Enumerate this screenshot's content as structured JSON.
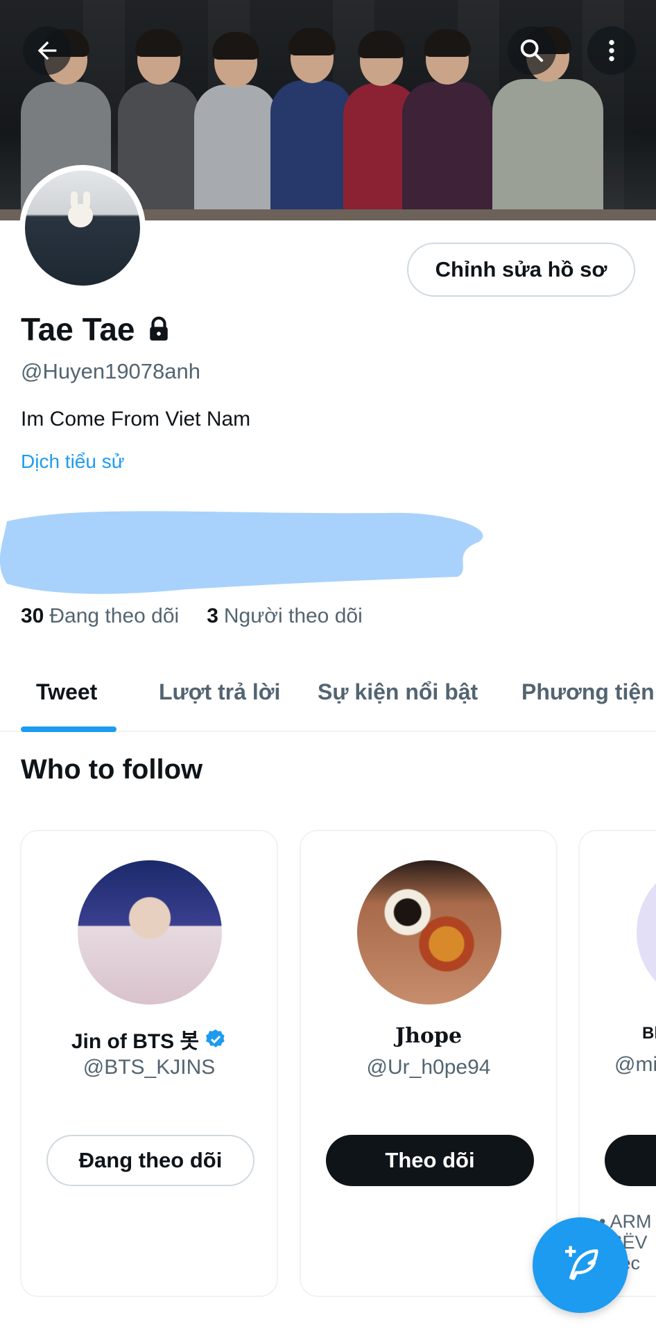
{
  "profile": {
    "name": "Tae Tae",
    "handle": "@Huyen19078anh",
    "bio": "Im Come From Viet Nam",
    "translate_bio": "Dịch tiểu sử",
    "edit_label": "Chỉnh sửa hồ sơ"
  },
  "stats": {
    "following_count": "30",
    "following_label": "Đang theo dõi",
    "followers_count": "3",
    "followers_label": "Người theo dõi"
  },
  "tabs": [
    {
      "label": "Tweet",
      "active": true
    },
    {
      "label": "Lượt trả lời"
    },
    {
      "label": "Sự kiện nổi bật"
    },
    {
      "label": "Phương tiện"
    }
  ],
  "who_to_follow": {
    "title": "Who to follow",
    "cards": [
      {
        "name": "Jin of BTS 봇",
        "verified": true,
        "handle": "@BTS_KJINS",
        "button": "Đang theo dõi"
      },
      {
        "name": "Jhope",
        "verified": false,
        "handle": "@Ur_h0pe94",
        "button": "Theo dõi"
      },
      {
        "name": "Bl",
        "handle": "@mi",
        "bullet_text": "ARM SËV hec"
      }
    ]
  },
  "colors": {
    "accent": "#1d9bf0",
    "text": "#0f1419",
    "muted": "#536471",
    "scribble": "#a8d2fb"
  },
  "icons": {
    "back": "back-arrow-icon",
    "search": "search-icon",
    "more": "more-vertical-icon",
    "lock": "lock-icon",
    "verified": "verified-badge-icon",
    "compose": "compose-feather-icon"
  }
}
